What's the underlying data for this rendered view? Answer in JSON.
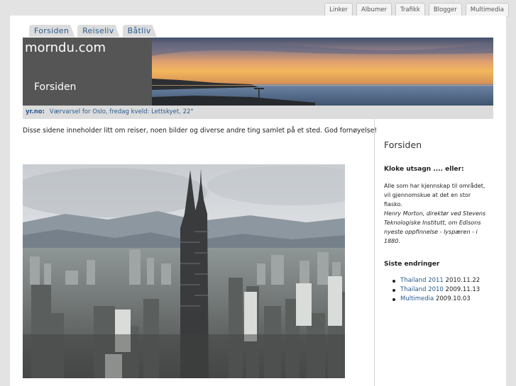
{
  "top_nav": [
    "Linker",
    "Albumer",
    "Trafikk",
    "Blogger",
    "Multimedia"
  ],
  "tabs": [
    "Forsiden",
    "Reiseliv",
    "Båtliv"
  ],
  "header": {
    "site_title": "morndu.com",
    "page_heading": "Forsiden"
  },
  "weather": {
    "source": "yr.no:",
    "text": "Værvarsel for Oslo, fredag kveld: Lettskyet, 22°"
  },
  "intro": "Disse sidene inneholder litt om reiser, noen bilder og diverse andre ting samlet på et sted.  God fornøyelse!",
  "sidebar": {
    "title": "Forsiden",
    "quote_heading": "Kloke utsagn .... eller:",
    "quote_text": "Alle som har kjennskap til området, vil gjennomskue at det en stor fiasko.",
    "quote_attribution": "Henry Morton, direktør ved Stevens Teknologiske Institutt, om Edisons nyeste oppfinnelse - lyspæren - i 1880.",
    "changes_heading": "Siste endringer",
    "changes": [
      {
        "link": "Thailand 2011",
        "date": "2010.11.22"
      },
      {
        "link": "Thailand 2010",
        "date": "2009.11.13"
      },
      {
        "link": "Multimedia",
        "date": "2009.10.03"
      }
    ]
  },
  "colors": {
    "link": "#2a5b8f",
    "header_dark": "#555555",
    "band": "#dcdcdc",
    "page_bg": "#e3e3e3"
  }
}
